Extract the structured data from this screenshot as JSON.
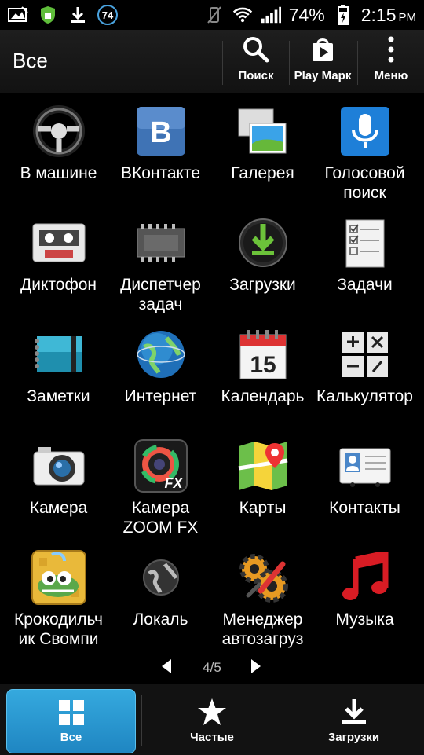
{
  "status": {
    "notification_count": "74",
    "battery": "74%",
    "time": "2:15",
    "ampm": "PM"
  },
  "actionbar": {
    "title": "Все",
    "search_label": "Поиск",
    "play_label": "Play Марк",
    "menu_label": "Меню"
  },
  "apps": [
    {
      "label": "В машине",
      "icon": "steering-wheel-icon"
    },
    {
      "label": "ВКонтакте",
      "icon": "vk-icon"
    },
    {
      "label": "Галерея",
      "icon": "gallery-icon"
    },
    {
      "label": "Голосовой\nпоиск",
      "icon": "microphone-icon"
    },
    {
      "label": "Диктофон",
      "icon": "cassette-icon"
    },
    {
      "label": "Диспетчер\nзадач",
      "icon": "chip-icon"
    },
    {
      "label": "Загрузки",
      "icon": "download-icon"
    },
    {
      "label": "Задачи",
      "icon": "checklist-icon"
    },
    {
      "label": "Заметки",
      "icon": "notebook-icon"
    },
    {
      "label": "Интернет",
      "icon": "globe-icon"
    },
    {
      "label": "Календарь",
      "icon": "calendar-icon",
      "day": "15"
    },
    {
      "label": "Калькулятор",
      "icon": "calculator-icon"
    },
    {
      "label": "Камера",
      "icon": "camera-icon"
    },
    {
      "label": "Камера\nZOOM FX",
      "icon": "camera-zoom-fx-icon",
      "badge": "FX"
    },
    {
      "label": "Карты",
      "icon": "maps-icon"
    },
    {
      "label": "Контакты",
      "icon": "contacts-icon"
    },
    {
      "label": "Крокодильч\nик Свомпи",
      "icon": "crocodile-game-icon"
    },
    {
      "label": "Локаль",
      "icon": "locale-globe-icon"
    },
    {
      "label": "Менеджер\nавтозагруз",
      "icon": "gears-icon"
    },
    {
      "label": "Музыка",
      "icon": "music-note-icon"
    }
  ],
  "pager": {
    "indicator": "4/5"
  },
  "tabs": {
    "all_label": "Все",
    "frequent_label": "Частые",
    "downloads_label": "Загрузки"
  },
  "colors": {
    "accent": "#2b9ad4",
    "background": "#000000"
  }
}
